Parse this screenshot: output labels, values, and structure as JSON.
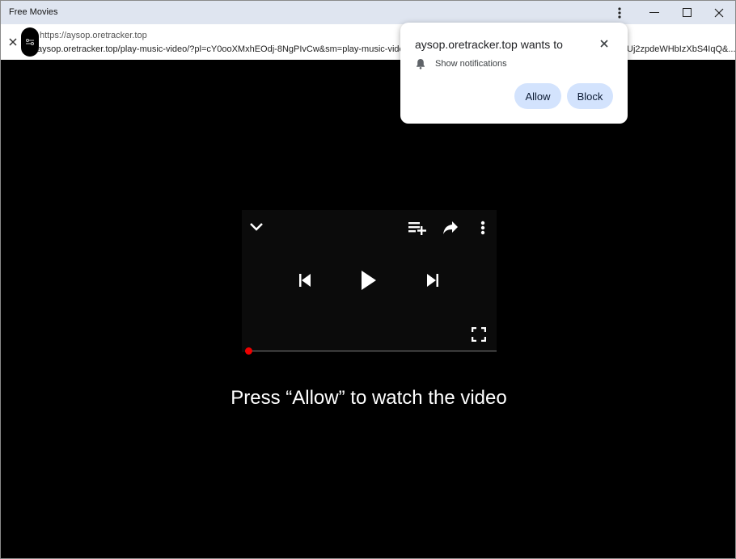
{
  "window": {
    "title": "Free Movies",
    "controls": [
      "menu-icon",
      "minimize-icon",
      "maximize-icon",
      "close-icon"
    ]
  },
  "addressbar": {
    "domain": "https://aysop.oretracker.top",
    "url": "aysop.oretracker.top/play-music-video/?pl=cY0ooXMxhEOdj-8NgPIvCw&sm=play-music-video&",
    "url_tail": "Uj2zpdeWHbIzXbS4IqQ&..."
  },
  "player": {
    "icons": [
      "chevron-down-icon",
      "add-to-queue-icon",
      "share-icon",
      "more-vert-icon",
      "skip-previous-icon",
      "play-icon",
      "skip-next-icon",
      "fullscreen-icon"
    ],
    "progress": 0,
    "progress_color": "#ee0000"
  },
  "cta": {
    "text": "Press “Allow” to watch the video"
  },
  "permission_popup": {
    "title": "aysop.oretracker.top wants to",
    "permission": "Show notifications",
    "allow_label": "Allow",
    "block_label": "Block",
    "button_color": "#d3e3fd"
  }
}
